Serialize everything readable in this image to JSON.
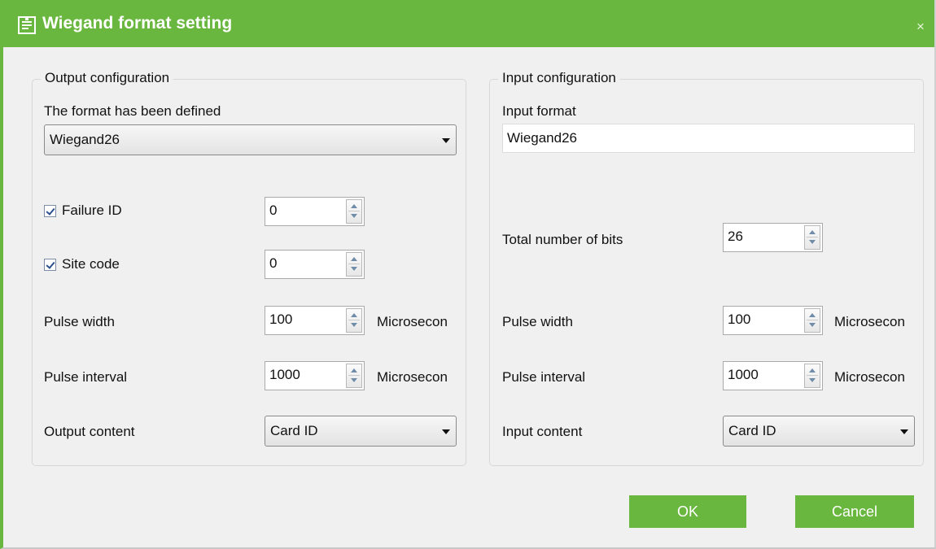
{
  "window": {
    "title": "Wiegand format setting",
    "close_glyph": "×",
    "accent": "#6ab73f"
  },
  "output": {
    "group_title": "Output configuration",
    "defined_label": "The format has been defined",
    "defined_value": "Wiegand26",
    "failure_id": {
      "label": "Failure ID",
      "checked": true,
      "value": "0"
    },
    "site_code": {
      "label": "Site code",
      "checked": true,
      "value": "0"
    },
    "pulse_width": {
      "label": "Pulse width",
      "value": "100",
      "unit": "Microsecon"
    },
    "pulse_interval": {
      "label": "Pulse interval",
      "value": "1000",
      "unit": "Microsecon"
    },
    "content": {
      "label": "Output content",
      "value": "Card ID"
    }
  },
  "input": {
    "group_title": "Input configuration",
    "format_label": "Input format",
    "format_value": "Wiegand26",
    "total_bits": {
      "label": "Total number of bits",
      "value": "26"
    },
    "pulse_width": {
      "label": "Pulse width",
      "value": "100",
      "unit": "Microsecon"
    },
    "pulse_interval": {
      "label": "Pulse interval",
      "value": "1000",
      "unit": "Microsecon"
    },
    "content": {
      "label": "Input content",
      "value": "Card ID"
    }
  },
  "buttons": {
    "ok": "OK",
    "cancel": "Cancel"
  },
  "icons": {
    "title": "form-settings-icon",
    "close": "close-icon",
    "dropdown": "chevron-down-icon"
  }
}
